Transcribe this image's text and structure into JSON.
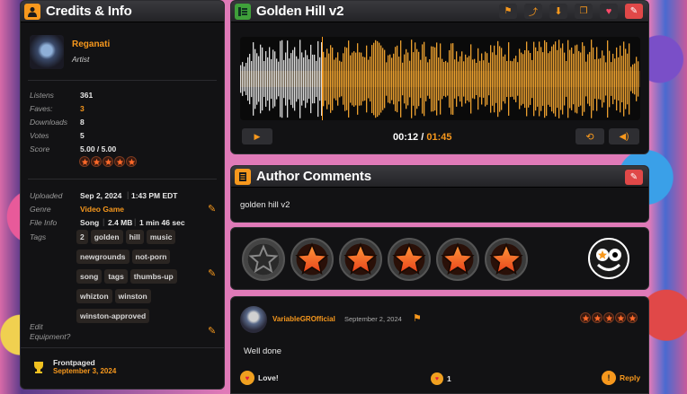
{
  "credits": {
    "title": "Credits & Info",
    "artist_name": "Reganati",
    "artist_role": "Artist",
    "stats": [
      {
        "label": "Listens",
        "value": "361",
        "accent": false
      },
      {
        "label": "Faves:",
        "value": "3",
        "accent": true
      },
      {
        "label": "Downloads",
        "value": "8",
        "accent": false
      },
      {
        "label": "Votes",
        "value": "5",
        "accent": false
      },
      {
        "label": "Score",
        "value": "5.00 / 5.00",
        "accent": false
      }
    ],
    "score_stars": 5,
    "uploaded_label": "Uploaded",
    "uploaded_date": "Sep 2, 2024",
    "uploaded_time": "1:43 PM EDT",
    "genre_label": "Genre",
    "genre_value": "Video Game",
    "fileinfo_label": "File Info",
    "file_type": "Song",
    "file_size": "2.4 MB",
    "file_length": "1 min 46 sec",
    "tags_label": "Tags",
    "tags": [
      "2",
      "golden",
      "hill",
      "music",
      "newgrounds",
      "not-porn",
      "song",
      "tags",
      "thumbs-up",
      "whizton",
      "winston",
      "winston-approved"
    ],
    "edit_label": "Edit",
    "equipment_label": "Equipment?",
    "frontpaged_label": "Frontpaged",
    "frontpaged_date": "September 3, 2024"
  },
  "player": {
    "title": "Golden Hill v2",
    "current_time": "00:12",
    "separator": "/",
    "total_time": "01:45",
    "progress": 0.114
  },
  "author_comments": {
    "title": "Author Comments",
    "text": "golden hill v2"
  },
  "vote": {
    "stars_count": 5
  },
  "review": {
    "username": "VariableGROfficial",
    "date": "September 2, 2024",
    "stars": 5,
    "text": "Well done",
    "love_label": "Love!",
    "reaction_count": "1",
    "reply_label": "Reply"
  },
  "colors": {
    "accent": "#f7981d",
    "panel_bg": "#121214",
    "header_bg": "#2a2a2e"
  }
}
